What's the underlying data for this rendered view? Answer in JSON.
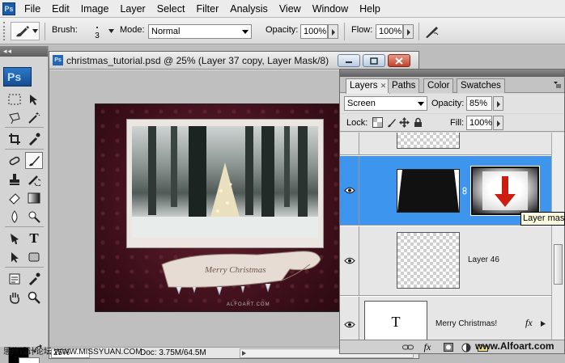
{
  "menu": [
    "File",
    "Edit",
    "Image",
    "Layer",
    "Select",
    "Filter",
    "Analysis",
    "View",
    "Window",
    "Help"
  ],
  "options": {
    "brush_label": "Brush:",
    "brush_size": "3",
    "mode_label": "Mode:",
    "mode_value": "Normal",
    "opacity_label": "Opacity:",
    "opacity_value": "100%",
    "flow_label": "Flow:",
    "flow_value": "100%"
  },
  "toolbox": {
    "logo": "Ps",
    "tools": [
      "marquee-icon",
      "move-icon",
      "lasso-icon",
      "magic-wand-icon",
      "crop-icon",
      "eyedropper-icon",
      "healing-icon",
      "brush-icon",
      "stamp-icon",
      "history-brush-icon",
      "eraser-icon",
      "gradient-icon",
      "blur-icon",
      "dodge-icon",
      "pen-icon",
      "type-icon",
      "path-select-icon",
      "shape-icon",
      "notes-icon",
      "eyedropper2-icon",
      "hand-icon",
      "zoom-icon"
    ],
    "active_tool": "brush-icon",
    "type_tool_glyph": "T",
    "foreground_color": "#000000",
    "background_color": "#ffffff"
  },
  "document": {
    "title": "christmas_tutorial.psd @ 25% (Layer 37 copy, Layer Mask/8)",
    "zoom": "25%",
    "doc_info": "Doc: 3.75M/64.5M",
    "artwork_text": "Merry Christmas",
    "artwork_credit": "ALFOART.COM"
  },
  "layers_panel": {
    "tabs": [
      {
        "label": "Layers",
        "active": true,
        "closable": true
      },
      {
        "label": "Paths",
        "active": false
      },
      {
        "label": "Color",
        "active": false
      },
      {
        "label": "Swatches",
        "active": false
      }
    ],
    "blend_mode": "Screen",
    "opacity_label": "Opacity:",
    "opacity_value": "85%",
    "lock_label": "Lock:",
    "fill_label": "Fill:",
    "fill_value": "100%",
    "layers": [
      {
        "name": "",
        "selected": false
      },
      {
        "name": "",
        "selected": true,
        "has_mask": true
      },
      {
        "name": "Layer 46",
        "selected": false
      },
      {
        "name": "Merry Christmas!",
        "selected": false,
        "is_text": true,
        "text_glyph": "T",
        "fx": "fx"
      }
    ],
    "bottom_fx": "fx",
    "tooltip": "Layer mask"
  },
  "watermarks": {
    "left": "思缘设计论坛  WWW.MISSYUAN.COM",
    "right": "www.Alfoart.com"
  },
  "colors": {
    "selection_blue": "#3e95ee",
    "mask_arrow_red": "#cc1d10",
    "artwork_bg": "#4a1220"
  }
}
